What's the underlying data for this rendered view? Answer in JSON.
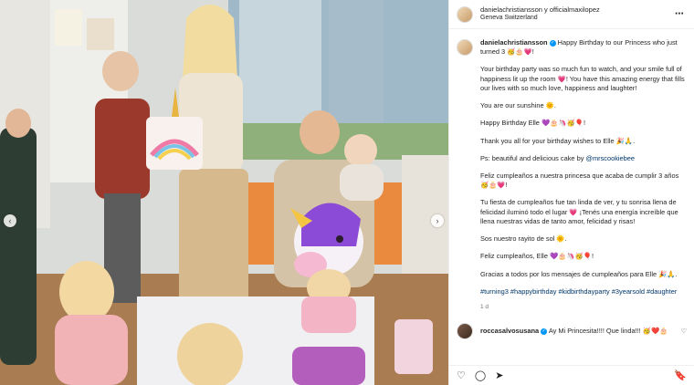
{
  "header": {
    "names": "danielachristiansson y officialmaxilopez",
    "location": "Geneva Switzerland",
    "more_icon": "⋯"
  },
  "caption": {
    "username": "danielachristiansson",
    "line1": "Happy Birthday to our Princess who just turned 3 🥳🎂💗!",
    "p2": "Your birthday party was so much fun to watch, and your smile full of happiness lit up the room 💗! You have this amazing energy that fills our lives with so much love, happiness and laughter!",
    "p3": "You are our sunshine 🌞.",
    "p4": "Happy Birthday Elle 💜🎂🦄🥳🎈!",
    "p5": "Thank you all for your birthday wishes to Elle 🎉🙏.",
    "p6_prefix": "Ps: beautiful and delicious cake by",
    "p6_link": "@mrscookiebee",
    "p7": "Feliz cumpleaños a nuestra princesa que acaba de cumplir 3 años 🥳🎂💗!",
    "p8": "Tu fiesta de cumpleaños fue tan linda de ver, y tu sonrisa llena de felicidad iluminó todo el lugar 💗 ¡Tenés una energía increíble que llena nuestras vidas de tanto amor, felicidad y risas!",
    "p9": "Sos nuestro rayito de sol 🌞.",
    "p10": "Feliz cumpleaños, Elle 💜🎂🦄🥳🎈!",
    "p11": "Gracias a todos por los mensajes de cumpleaños para Elle 🎉🙏.",
    "hashtags": "#turning3 #happybirthday #kidbirthdayparty #3yearsold #daughter",
    "time": "1 d"
  },
  "comment": {
    "username": "roccasalvosusana",
    "text": "Ay Mi Princesita!!!! Que linda!!! 🥳❤️🎂"
  },
  "actions": {
    "like_icon": "♡",
    "comment_icon": "◯",
    "share_icon": "➤",
    "save_icon": "🔖"
  },
  "nav": {
    "prev": "‹",
    "next": "›"
  },
  "colors": {
    "link": "#00376b",
    "verified": "#0095f6",
    "muted": "#737373"
  }
}
